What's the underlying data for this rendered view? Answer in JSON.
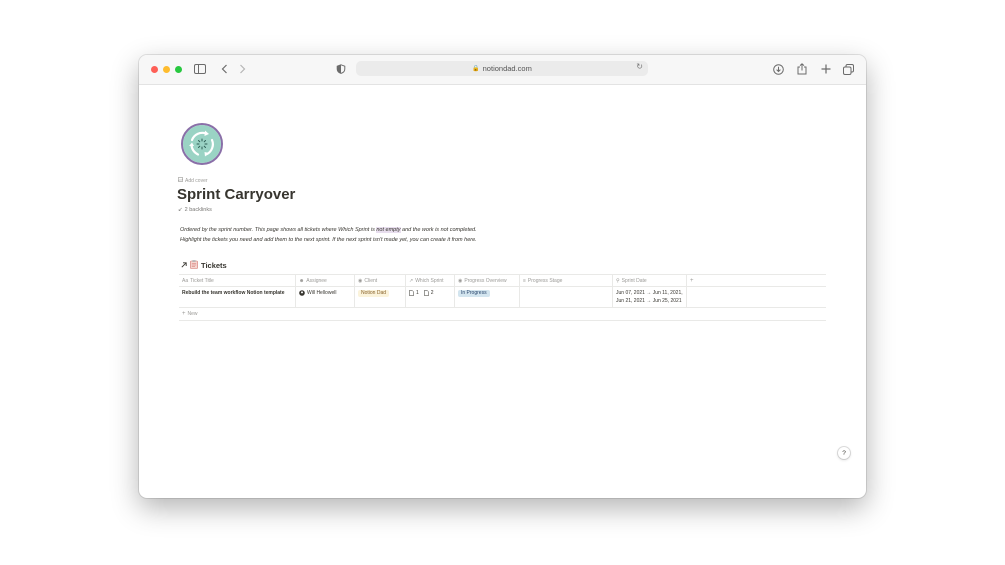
{
  "browser": {
    "url": "notiondad.com"
  },
  "page": {
    "add_cover": "Add cover",
    "title": "Sprint Carryover",
    "backlinks": "2 backlinks",
    "description_line1_prefix": "Ordered by the sprint number. This page shows all tickets where Which Sprint is ",
    "description_highlight": "not empty",
    "description_line1_suffix": " and the work is not completed.",
    "description_line2": "Highlight the tickets you need and add them to the next sprint. If the next sprint isn't made yet, you can create it from here."
  },
  "database": {
    "title": "Tickets",
    "columns": [
      {
        "label": "Ticket Title",
        "icon": "text-icon"
      },
      {
        "label": "Assignee",
        "icon": "person-icon"
      },
      {
        "label": "Client",
        "icon": "select-icon"
      },
      {
        "label": "Which Sprint",
        "icon": "relation-arrow-icon"
      },
      {
        "label": "Progress Overview",
        "icon": "select-icon"
      },
      {
        "label": "Progress Stage",
        "icon": "multi-select-icon"
      },
      {
        "label": "Sprint Date",
        "icon": "search-icon"
      }
    ],
    "add_column": "+",
    "rows": [
      {
        "ticket_title": "Rebuild the team workflow Notion template",
        "assignee": "Will Hellowell",
        "client": "Notion Dad",
        "sprints": [
          "1",
          "2"
        ],
        "progress_overview": "In Progress",
        "progress_stage": "",
        "dates": [
          "Jun 07, 2021 → Jun 11, 2021,",
          "Jun 21, 2021 → Jun 25, 2021"
        ]
      }
    ],
    "new_label": "New"
  },
  "help": "?",
  "colors": {
    "client_tag_bg": "#fbf3db",
    "progress_tag_bg": "#d3e5ef",
    "highlight_bg": "#e8deee",
    "icon_teal": "#9ad3c4",
    "icon_border": "#8a6fa8"
  }
}
